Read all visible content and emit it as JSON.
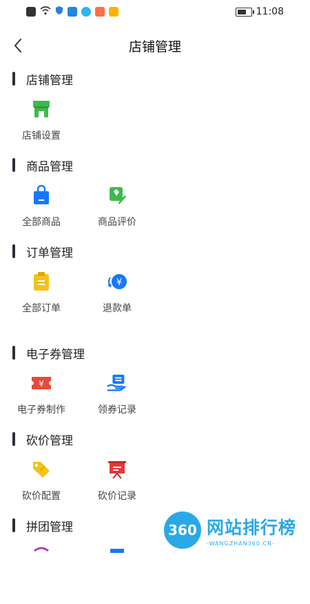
{
  "status_bar": {
    "time": "11:08"
  },
  "header": {
    "title": "店铺管理"
  },
  "sections": [
    {
      "title": "店铺管理",
      "items": [
        {
          "label": "店铺设置",
          "icon": "store-icon"
        }
      ]
    },
    {
      "title": "商品管理",
      "items": [
        {
          "label": "全部商品",
          "icon": "shopping-bag-icon"
        },
        {
          "label": "商品评价",
          "icon": "tag-edit-icon"
        }
      ]
    },
    {
      "title": "订单管理",
      "items": [
        {
          "label": "全部订单",
          "icon": "clipboard-icon"
        },
        {
          "label": "退款单",
          "icon": "refund-yen-icon"
        }
      ]
    },
    {
      "title": "电子券管理",
      "items": [
        {
          "label": "电子券制作",
          "icon": "coupon-yen-icon"
        },
        {
          "label": "领券记录",
          "icon": "coupon-hand-icon"
        }
      ]
    },
    {
      "title": "砍价管理",
      "items": [
        {
          "label": "砍价配置",
          "icon": "price-tag-icon"
        },
        {
          "label": "砍价记录",
          "icon": "board-icon"
        }
      ]
    },
    {
      "title": "拼团管理",
      "items": []
    }
  ],
  "watermark": {
    "logo_text": "360",
    "title": "网站排行榜",
    "subtitle": "-WANGZHAN360.CN-"
  },
  "colors": {
    "accent_blue": "#1677ff",
    "green": "#3dbb4c",
    "yellow": "#f5c21b",
    "red": "#e64a3c",
    "watermark": "#2aa8e8"
  }
}
